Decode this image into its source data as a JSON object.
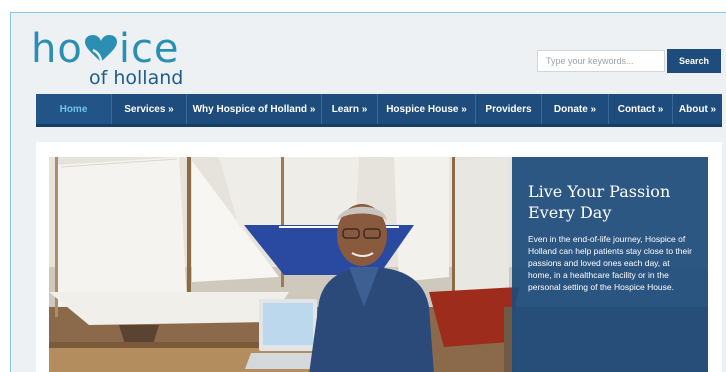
{
  "logo": {
    "main_prefix": "ho",
    "main_suffix": "ice",
    "sub": "of holland",
    "brand_color": "#2a8fb3",
    "sub_color": "#1f5d8b"
  },
  "search": {
    "placeholder": "Type your keywords...",
    "value": "",
    "button_label": "Search"
  },
  "nav": {
    "items": [
      {
        "label": "Home",
        "active": true
      },
      {
        "label": "Services »"
      },
      {
        "label": "Why Hospice of Holland »"
      },
      {
        "label": "Learn »"
      },
      {
        "label": "Hospice House »"
      },
      {
        "label": "Providers"
      },
      {
        "label": "Donate »"
      },
      {
        "label": "Contact »"
      },
      {
        "label": "About »"
      }
    ],
    "bg_color": "#1e4c7c",
    "active_color": "#6fc3ea"
  },
  "hero": {
    "title": "Live Your Passion Every Day",
    "text": "Even in the end-of-life journey, Hospice of Holland can help patients stay close to their passions and loved ones each day, at home, in a healthcare facility or in the personal setting of the Hospice House.",
    "overlay_color": "#1e4c7c",
    "image_subject": "man-with-model-sailboats-photo"
  }
}
